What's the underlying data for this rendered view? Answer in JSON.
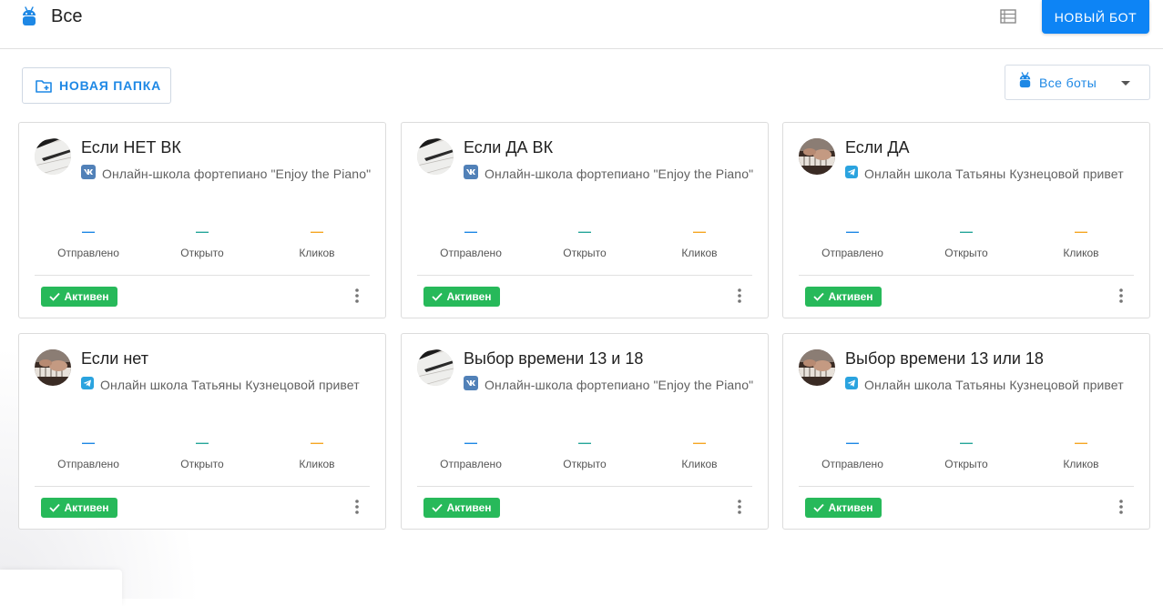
{
  "header": {
    "title": "Все",
    "new_bot_label": "НОВЫЙ БОТ"
  },
  "toolbar": {
    "new_folder_label": "НОВАЯ ПАПКА",
    "bots_filter_label": "Все боты"
  },
  "colors": {
    "accent": "#0d84f5",
    "active_badge": "#27b95a",
    "sent_dash": "#1e88e5",
    "opened_dash": "#26a69a",
    "clicks_dash": "#f5a623"
  },
  "cards": [
    {
      "name": "Если НЕТ ВК",
      "source_icon": "vk-icon",
      "source": "Онлайн-школа фортепиано \"Enjoy the Piano\"",
      "stats": [
        {
          "value": "—",
          "label": "Отправлено"
        },
        {
          "value": "—",
          "label": "Открыто"
        },
        {
          "value": "—",
          "label": "Кликов"
        }
      ],
      "status": "Активен"
    },
    {
      "name": "Если ДА ВК",
      "source_icon": "vk-icon",
      "source": "Онлайн-школа фортепиано \"Enjoy the Piano\"",
      "stats": [
        {
          "value": "—",
          "label": "Отправлено"
        },
        {
          "value": "—",
          "label": "Открыто"
        },
        {
          "value": "—",
          "label": "Кликов"
        }
      ],
      "status": "Активен"
    },
    {
      "name": "Если ДА",
      "source_icon": "telegram-icon",
      "source": "Онлайн школа Татьяны Кузнецовой привет",
      "stats": [
        {
          "value": "—",
          "label": "Отправлено"
        },
        {
          "value": "—",
          "label": "Открыто"
        },
        {
          "value": "—",
          "label": "Кликов"
        }
      ],
      "status": "Активен"
    },
    {
      "name": "Если нет",
      "source_icon": "telegram-icon",
      "source": "Онлайн школа Татьяны Кузнецовой привет",
      "stats": [
        {
          "value": "—",
          "label": "Отправлено"
        },
        {
          "value": "—",
          "label": "Открыто"
        },
        {
          "value": "—",
          "label": "Кликов"
        }
      ],
      "status": "Активен"
    },
    {
      "name": "Выбор времени 13 и 18",
      "source_icon": "vk-icon",
      "source": "Онлайн-школа фортепиано \"Enjoy the Piano\"",
      "stats": [
        {
          "value": "—",
          "label": "Отправлено"
        },
        {
          "value": "—",
          "label": "Открыто"
        },
        {
          "value": "—",
          "label": "Кликов"
        }
      ],
      "status": "Активен"
    },
    {
      "name": "Выбор времени 13 или 18",
      "source_icon": "telegram-icon",
      "source": "Онлайн школа Татьяны Кузнецовой привет",
      "stats": [
        {
          "value": "—",
          "label": "Отправлено"
        },
        {
          "value": "—",
          "label": "Открыто"
        },
        {
          "value": "—",
          "label": "Кликов"
        }
      ],
      "status": "Активен"
    }
  ]
}
